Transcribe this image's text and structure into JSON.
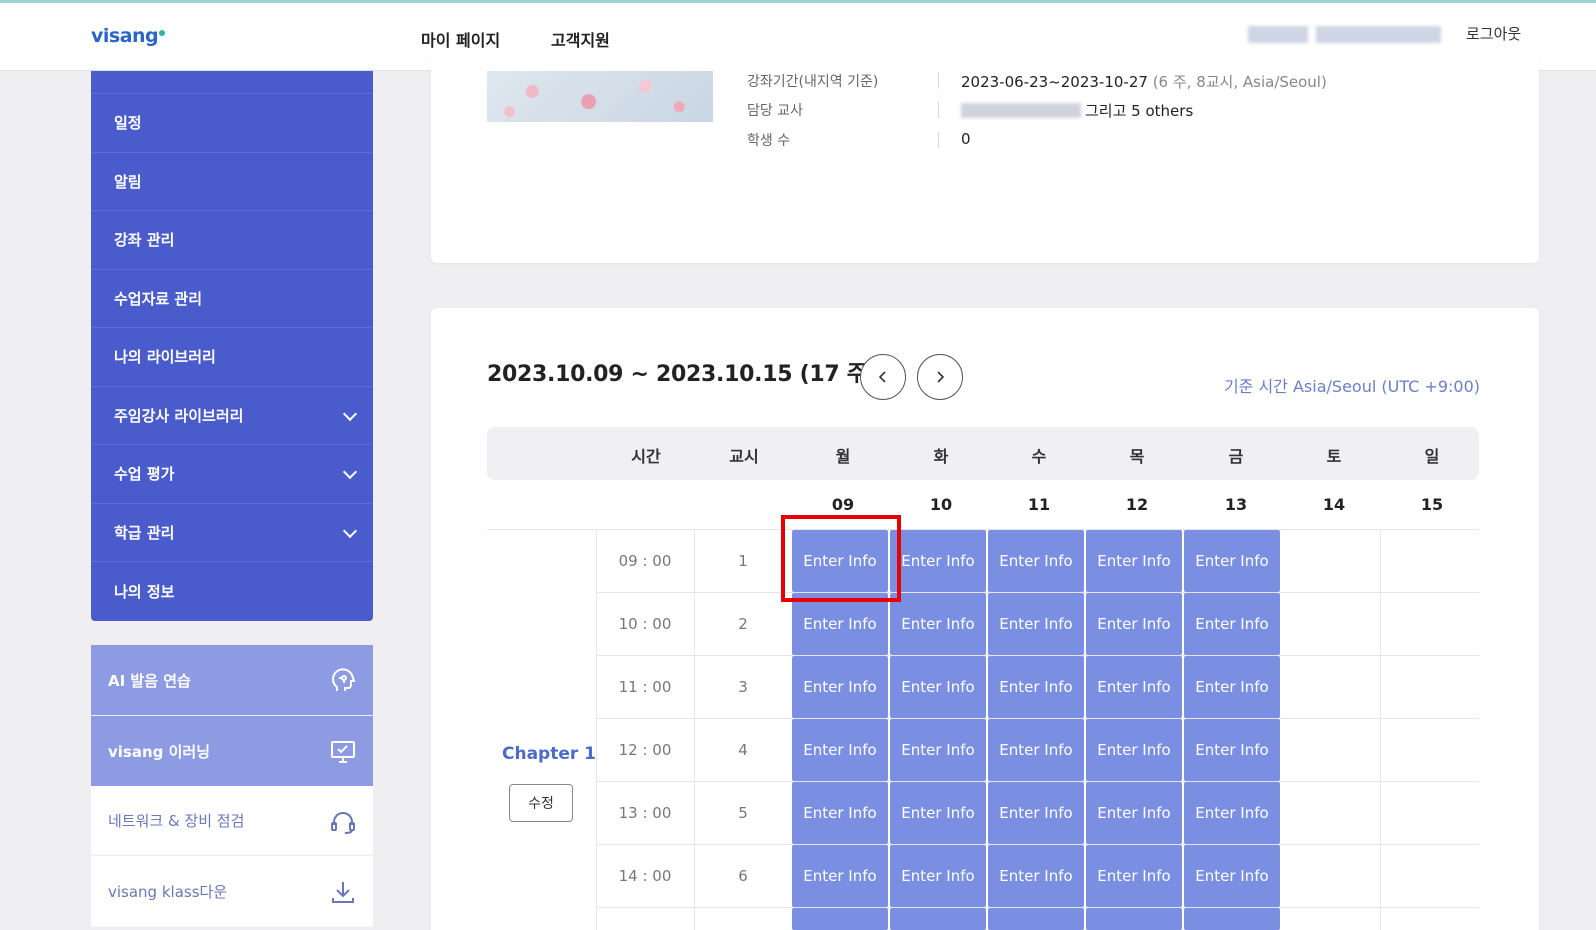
{
  "header": {
    "logo": "visang",
    "nav": [
      "마이 페이지",
      "고객지원"
    ],
    "logout": "로그아웃"
  },
  "sidebar": {
    "cutoff_label": "",
    "items": [
      {
        "label": "일정",
        "expandable": false
      },
      {
        "label": "알림",
        "expandable": false
      },
      {
        "label": "강좌 관리",
        "expandable": false
      },
      {
        "label": "수업자료 관리",
        "expandable": false
      },
      {
        "label": "나의 라이브러리",
        "expandable": false
      },
      {
        "label": "주임강사 라이브러리",
        "expandable": true
      },
      {
        "label": "수업 평가",
        "expandable": true
      },
      {
        "label": "학급 관리",
        "expandable": true
      },
      {
        "label": "나의 정보",
        "expandable": false
      }
    ],
    "quick_links": [
      {
        "label": "AI 발음 연습",
        "icon": "voice-ai-icon"
      },
      {
        "label": "visang 이러닝",
        "icon": "monitor-check-icon"
      },
      {
        "label": "네트워크 & 장비 점검",
        "icon": "headset-icon"
      },
      {
        "label": "visang klass다운",
        "icon": "download-icon"
      }
    ]
  },
  "course_info": {
    "period_label": "강좌기간(내지역 기준)",
    "period_value": "2023-06-23~2023-10-27",
    "period_detail": "(6 주,  8교시,  Asia/Seoul)",
    "teacher_label": "담당 교사",
    "teacher_value": "그리고 5 others",
    "students_label": "학생 수",
    "students_value": "0"
  },
  "schedule": {
    "week_title": "2023.10.09 ~ 2023.10.15 (17 주)",
    "timezone": "기준 시간 Asia/Seoul (UTC +9:00)",
    "col_time": "시간",
    "col_period": "교시",
    "days": [
      "월",
      "화",
      "수",
      "목",
      "금",
      "토",
      "일"
    ],
    "dates": [
      "09",
      "10",
      "11",
      "12",
      "13",
      "14",
      "15"
    ],
    "rows": [
      {
        "time": "09 : 00",
        "period": "1"
      },
      {
        "time": "10 : 00",
        "period": "2"
      },
      {
        "time": "11 : 00",
        "period": "3"
      },
      {
        "time": "12 : 00",
        "period": "4"
      },
      {
        "time": "13 : 00",
        "period": "5"
      },
      {
        "time": "14 : 00",
        "period": "6"
      }
    ],
    "slot_label": "Enter Info",
    "chapter": "Chapter 1",
    "edit_label": "수정"
  },
  "colors": {
    "sidebar_bg": "#4a5ccb",
    "slot_bg": "#7b8fe2",
    "highlight": "#e60000",
    "accent_text": "#4a6bc9"
  }
}
